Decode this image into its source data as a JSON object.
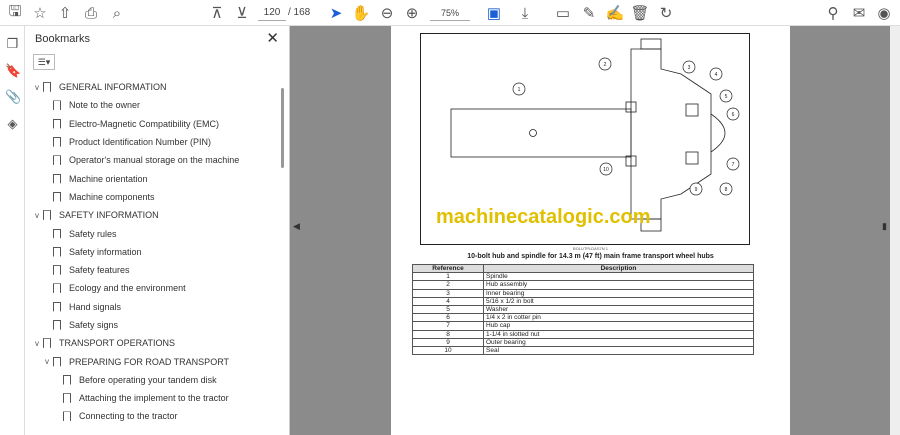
{
  "toolbar": {
    "page_current": "120",
    "page_total": "/ 168",
    "zoom": "75%"
  },
  "panel": {
    "title": "Bookmarks",
    "close": "✕",
    "options": "☰▾"
  },
  "bookmarks": [
    {
      "label": "GENERAL INFORMATION",
      "level": 0,
      "expand": "v"
    },
    {
      "label": "Note to the owner",
      "level": 1,
      "expand": ""
    },
    {
      "label": "Electro-Magnetic Compatibility (EMC)",
      "level": 1,
      "expand": ""
    },
    {
      "label": "Product Identification Number (PIN)",
      "level": 1,
      "expand": ""
    },
    {
      "label": "Operator's manual storage on the machine",
      "level": 1,
      "expand": ""
    },
    {
      "label": "Machine orientation",
      "level": 1,
      "expand": ""
    },
    {
      "label": "Machine components",
      "level": 1,
      "expand": ""
    },
    {
      "label": "SAFETY INFORMATION",
      "level": 0,
      "expand": "v"
    },
    {
      "label": "Safety rules",
      "level": 1,
      "expand": ""
    },
    {
      "label": "Safety information",
      "level": 1,
      "expand": ""
    },
    {
      "label": "Safety features",
      "level": 1,
      "expand": ""
    },
    {
      "label": "Ecology and the environment",
      "level": 1,
      "expand": ""
    },
    {
      "label": "Hand signals",
      "level": 1,
      "expand": ""
    },
    {
      "label": "Safety signs",
      "level": 1,
      "expand": ""
    },
    {
      "label": "TRANSPORT OPERATIONS",
      "level": 0,
      "expand": "v"
    },
    {
      "label": "PREPARING FOR ROAD TRANSPORT",
      "level": 1,
      "expand": "v"
    },
    {
      "label": "Before operating your tandem disk",
      "level": 2,
      "expand": ""
    },
    {
      "label": "Attaching the implement to the tractor",
      "level": 2,
      "expand": ""
    },
    {
      "label": "Connecting to the tractor",
      "level": 2,
      "expand": ""
    }
  ],
  "document": {
    "watermark": "machinecatalogic.com",
    "figure_id": "BOLUTPLDAS7N   1",
    "callouts": [
      "1",
      "2",
      "3",
      "4",
      "5",
      "6",
      "7",
      "8",
      "9",
      "10"
    ],
    "caption": "10-bolt hub and spindle for 14.3 m (47 ft) main frame transport wheel hubs",
    "table": {
      "headers": [
        "Reference",
        "Description"
      ],
      "rows": [
        [
          "1",
          "Spindle"
        ],
        [
          "2",
          "Hub assembly"
        ],
        [
          "3",
          "Inner bearing"
        ],
        [
          "4",
          "5/16 x 1/2 in bolt"
        ],
        [
          "5",
          "Washer"
        ],
        [
          "6",
          "1/4 x 2 in cotter pin"
        ],
        [
          "7",
          "Hub cap"
        ],
        [
          "8",
          "1-1/4 in slotted nut"
        ],
        [
          "9",
          "Outer bearing"
        ],
        [
          "10",
          "Seal"
        ]
      ]
    }
  }
}
